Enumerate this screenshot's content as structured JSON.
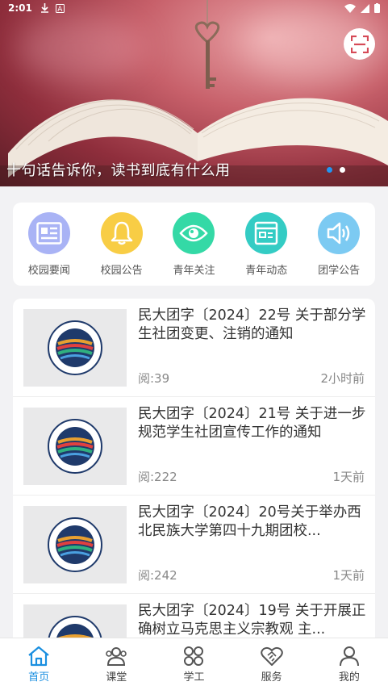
{
  "status_bar": {
    "time": "2:01"
  },
  "banner": {
    "caption": "十句话告诉你，读书到底有什么用",
    "active_dot": 0,
    "dot_count": 2
  },
  "quick_nav": [
    {
      "label": "校园要闻",
      "icon": "newspaper-icon",
      "color": "#a9b3f5"
    },
    {
      "label": "校园公告",
      "icon": "bell-icon",
      "color": "#f8cd45"
    },
    {
      "label": "青年关注",
      "icon": "eye-icon",
      "color": "#34d9a6"
    },
    {
      "label": "青年动态",
      "icon": "news-board-icon",
      "color": "#34ccc4"
    },
    {
      "label": "团学公告",
      "icon": "speaker-icon",
      "color": "#7ccaf2"
    }
  ],
  "news": [
    {
      "title": "民大团字〔2024〕22号 关于部分学生社团变更、注销的通知",
      "views": "阅:39",
      "time": "2小时前"
    },
    {
      "title": "民大团字〔2024〕21号 关于进一步规范学生社团宣传工作的通知",
      "views": "阅:222",
      "time": "1天前"
    },
    {
      "title": "民大团字〔2024〕20号关于举办西北民族大学第四十九期团校...",
      "views": "阅:242",
      "time": "1天前"
    },
    {
      "title": "民大团字〔2024〕19号 关于开展正确树立马克思主义宗教观 主...",
      "views": "",
      "time": ""
    }
  ],
  "bottom_nav": [
    {
      "label": "首页",
      "icon": "home-icon",
      "active": true
    },
    {
      "label": "课堂",
      "icon": "people-icon",
      "active": false
    },
    {
      "label": "学工",
      "icon": "grid-icon",
      "active": false
    },
    {
      "label": "服务",
      "icon": "handshake-icon",
      "active": false
    },
    {
      "label": "我的",
      "icon": "user-icon",
      "active": false
    }
  ],
  "colors": {
    "accent": "#1a8fe0",
    "dot_active": "#2196f3"
  }
}
